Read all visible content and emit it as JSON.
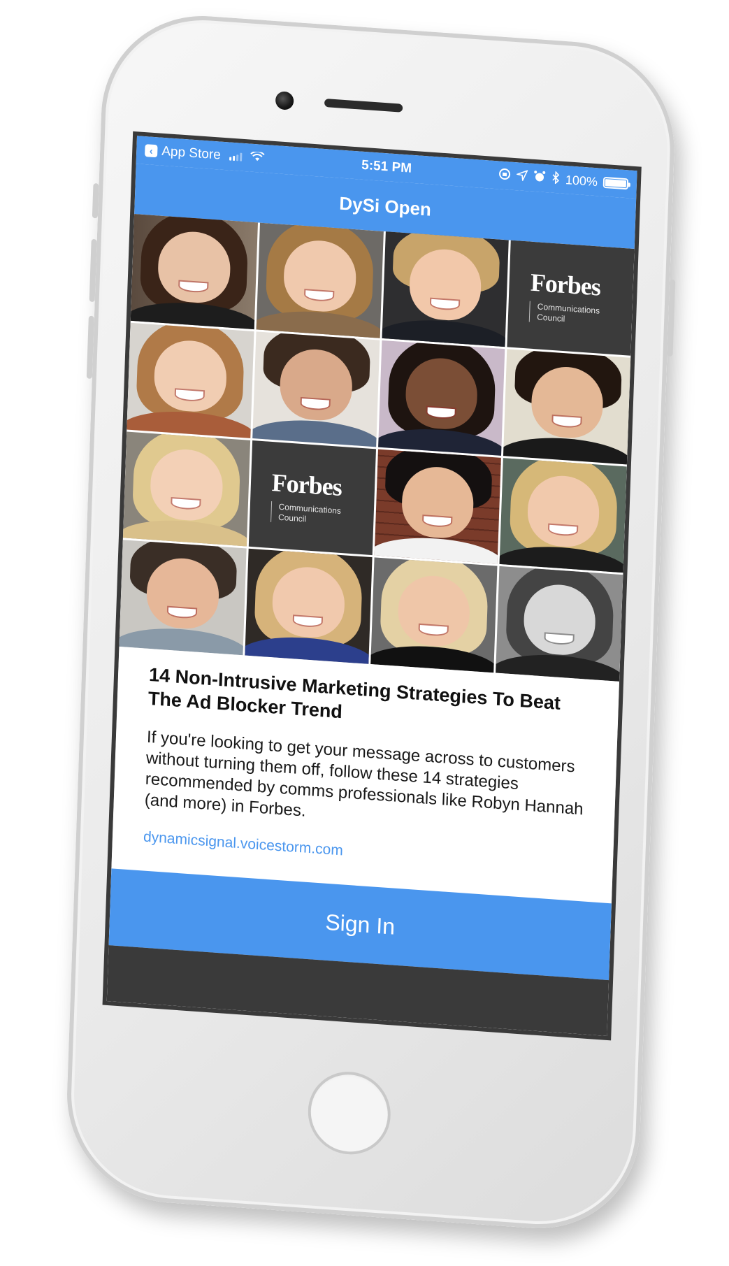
{
  "status_bar": {
    "back_label": "App Store",
    "time": "5:51 PM",
    "battery": "100%",
    "battery_level": 1.0
  },
  "nav": {
    "title": "DySi Open"
  },
  "header_image": {
    "forbes_logo": "Forbes",
    "forbes_subtitle_line1": "Communications",
    "forbes_subtitle_line2": "Council"
  },
  "article": {
    "title": "14 Non-Intrusive Marketing Strategies To Beat The Ad Blocker Trend",
    "summary": "If you're looking to get your message across to customers without turning them off, follow these 14 strategies recommended by comms professionals like Robyn Hannah (and more) in Forbes.",
    "link": "dynamicsignal.voicestorm.com"
  },
  "actions": {
    "sign_in": "Sign In"
  },
  "colors": {
    "accent": "#4a96ee",
    "phone_bezel": "#3a3a3a",
    "forbes_tile": "#3b3b3b"
  },
  "icons": {
    "back": "back-chevron-icon",
    "cellular": "cellular-signal-icon",
    "wifi": "wifi-icon",
    "lock_rotation": "orientation-lock-icon",
    "location": "location-arrow-icon",
    "alarm": "alarm-clock-icon",
    "bluetooth": "bluetooth-icon",
    "battery": "battery-icon"
  }
}
